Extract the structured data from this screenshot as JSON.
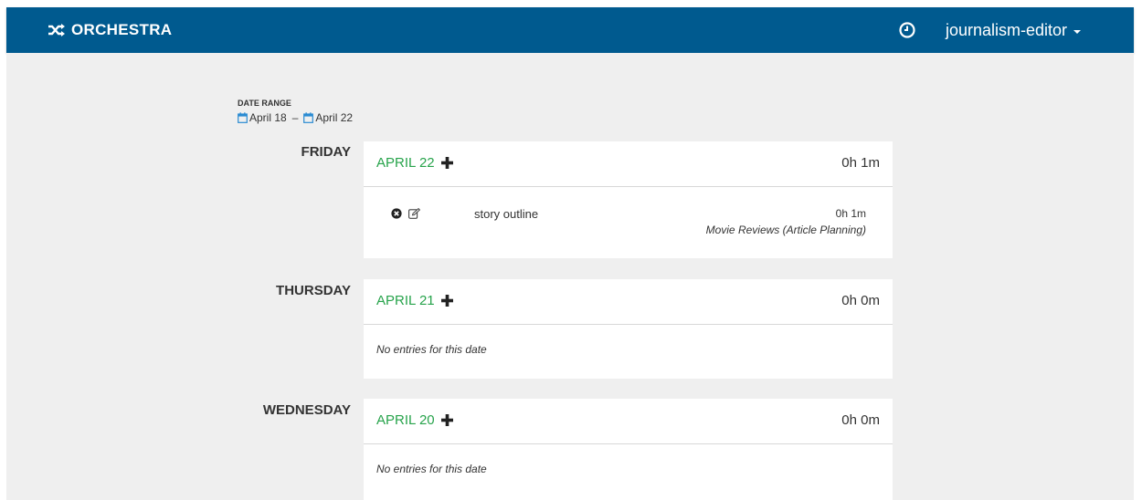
{
  "header": {
    "brand": "ORCHESTRA",
    "username": "journalism-editor",
    "brand_icon": "shuffle-icon",
    "timer_icon": "clock-icon",
    "bar_color": "#005a8f"
  },
  "date_range": {
    "label": "DATE RANGE",
    "start": "April 18",
    "separator": "–",
    "end": "April 22"
  },
  "days": [
    {
      "weekday": "FRIDAY",
      "date": "APRIL 22",
      "total": "0h 1m",
      "entries": [
        {
          "description": "story outline",
          "duration": "0h 1m",
          "task": "Movie Reviews (Article Planning)"
        }
      ]
    },
    {
      "weekday": "THURSDAY",
      "date": "APRIL 21",
      "total": "0h 0m",
      "empty_text": "No entries for this date"
    },
    {
      "weekday": "WEDNESDAY",
      "date": "APRIL 20",
      "total": "0h 0m",
      "empty_text": "No entries for this date"
    }
  ],
  "colors": {
    "accent_green": "#27a34b",
    "calendar_blue": "#2a8bd2",
    "background": "#efefef"
  }
}
